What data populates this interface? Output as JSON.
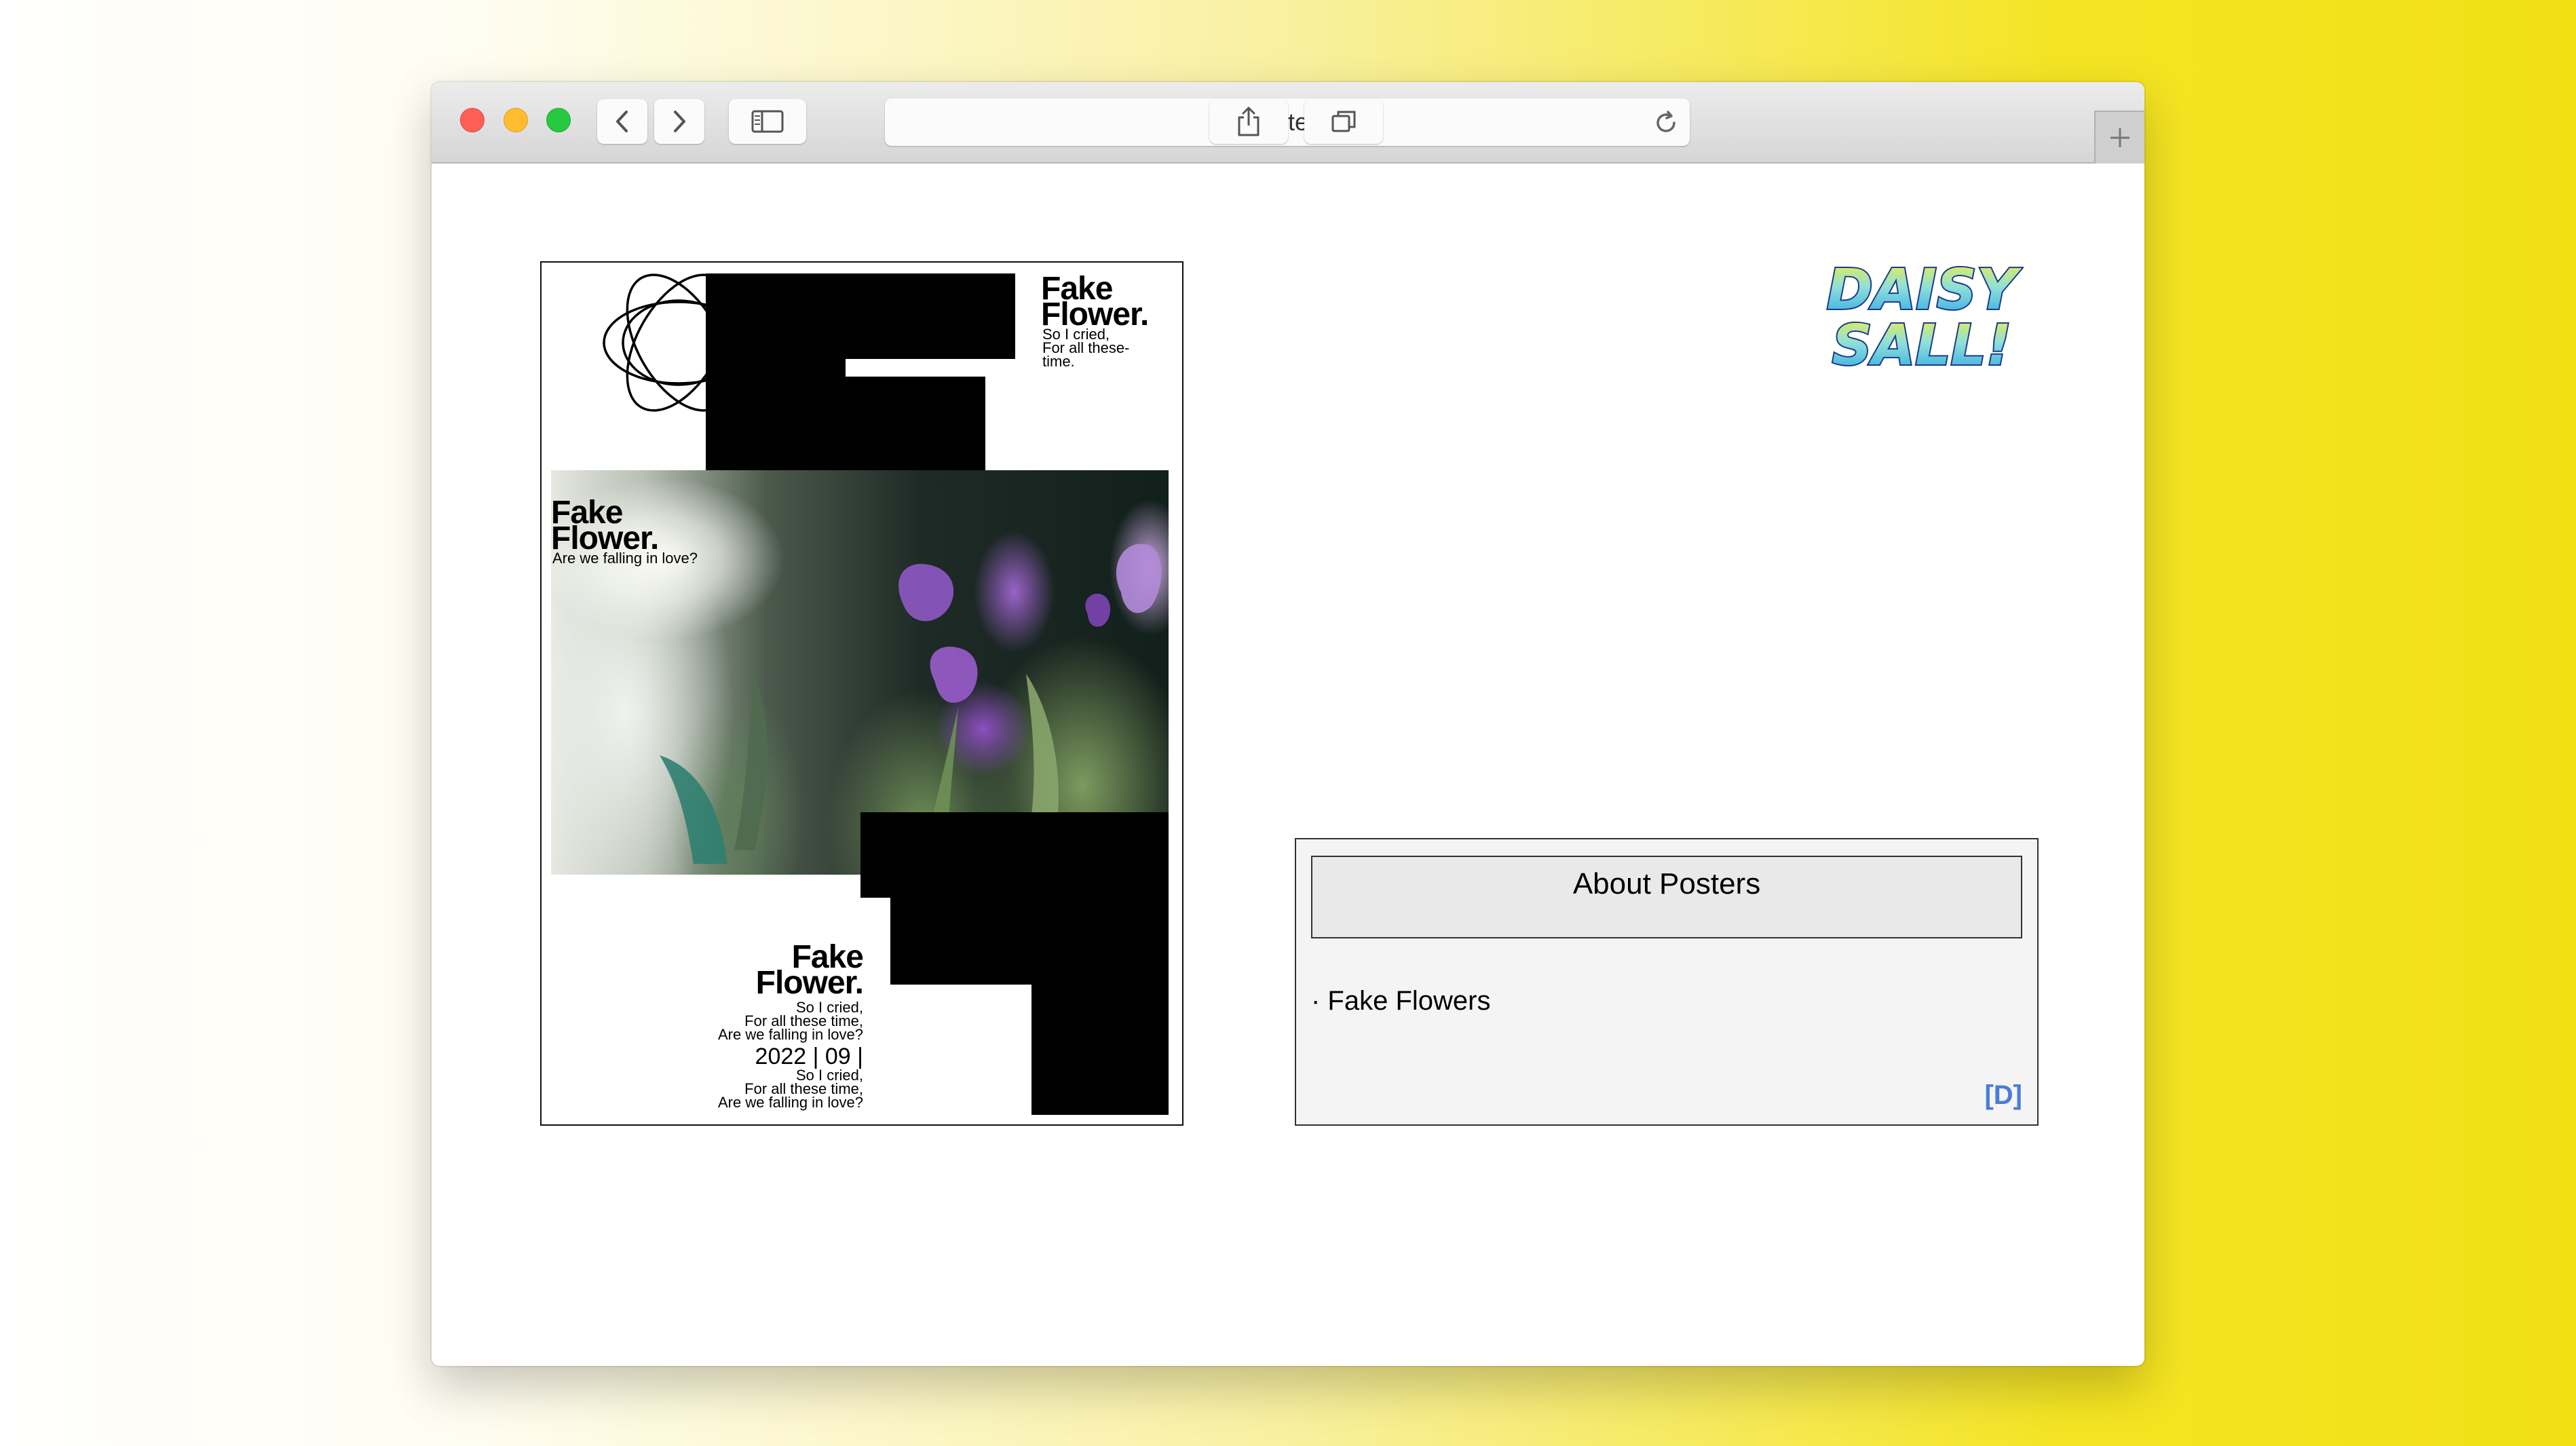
{
  "browser": {
    "page_title": "Posters",
    "icons": {
      "back": "chevron-left-icon",
      "forward": "chevron-right-icon",
      "sidebar": "sidebar-icon",
      "reload": "reload-icon",
      "share": "share-icon",
      "tabs": "tabs-icon",
      "new_tab": "plus-icon"
    }
  },
  "poster": {
    "top_title_line1": "Fake",
    "top_title_line2": "Flower.",
    "top_sub_line1": "So I cried,",
    "top_sub_line2": "For all these-",
    "top_sub_line3": "time.",
    "mid_title_line1": "Fake",
    "mid_title_line2": "Flower.",
    "mid_sub": "Are we falling in love?",
    "bottom_title_line1": "Fake",
    "bottom_title_line2": "Flower.",
    "bottom_lines_a": [
      "So I cried,",
      "For all these time,",
      "Are we falling in love?"
    ],
    "date": "2022 | 09 |",
    "bottom_lines_b": [
      "So I cried,",
      "For all these time,",
      "Are we falling in love?"
    ]
  },
  "logo": {
    "line1": "DAISY",
    "line2": "SALL!"
  },
  "about": {
    "heading": "About Posters",
    "item": "· Fake Flowers",
    "link": "[D]"
  },
  "colors": {
    "accent_link": "#4a7cd8",
    "background_yellow": "#f2df14"
  }
}
